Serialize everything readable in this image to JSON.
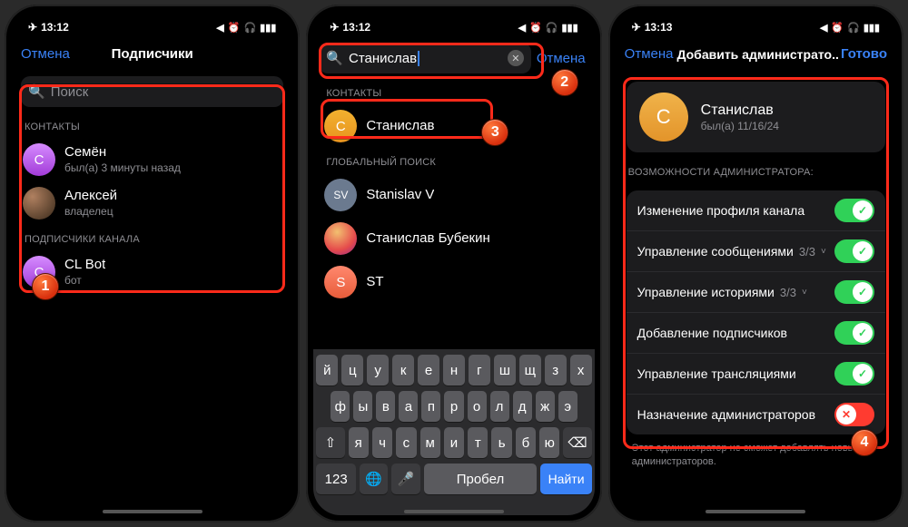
{
  "status": {
    "time1": "13:12",
    "time2": "13:12",
    "time3": "13:13"
  },
  "p1": {
    "cancel": "Отмена",
    "title": "Подписчики",
    "search_ph": "Поиск",
    "sec_contacts": "КОНТАКТЫ",
    "sec_subs": "ПОДПИСЧИКИ КАНАЛА",
    "c1": {
      "name": "Семён",
      "sub": "был(а) 3 минуты назад",
      "initial": "С"
    },
    "c2": {
      "name": "Алексей",
      "sub": "владелец"
    },
    "c3": {
      "name": "CL Bot",
      "sub": "бот",
      "initial": "C"
    }
  },
  "p2": {
    "cancel": "Отмена",
    "search_val": "Станислав",
    "sec_contacts": "КОНТАКТЫ",
    "sec_global": "ГЛОБАЛЬНЫЙ ПОИСК",
    "r1": {
      "name": "Станислав",
      "initial": "С"
    },
    "r2": {
      "name": "Stanislav V",
      "initial": "SV"
    },
    "r3": {
      "name": "Станислав Бубекин"
    },
    "r4": {
      "name": "ST",
      "initial": "S"
    },
    "kbd": {
      "r1": [
        "й",
        "ц",
        "у",
        "к",
        "е",
        "н",
        "г",
        "ш",
        "щ",
        "з",
        "х"
      ],
      "r2": [
        "ф",
        "ы",
        "в",
        "а",
        "п",
        "р",
        "о",
        "л",
        "д",
        "ж",
        "э"
      ],
      "r3": [
        "я",
        "ч",
        "с",
        "м",
        "и",
        "т",
        "ь",
        "б",
        "ю"
      ],
      "shift": "⇧",
      "bksp": "⌫",
      "num": "123",
      "globe": "🌐",
      "mic": "🎤",
      "space": "Пробел",
      "find": "Найти"
    }
  },
  "p3": {
    "cancel": "Отмена",
    "title": "Добавить администрато...",
    "done": "Готово",
    "profile": {
      "name": "Станислав",
      "sub": "был(а) 11/16/24",
      "initial": "С"
    },
    "sec": "ВОЗМОЖНОСТИ АДМИНИСТРАТОРА:",
    "perms": [
      {
        "label": "Изменение профиля канала",
        "on": true
      },
      {
        "label": "Управление сообщениями",
        "count": "3/3",
        "chev": true,
        "on": true
      },
      {
        "label": "Управление историями",
        "count": "3/3",
        "chev": true,
        "on": true
      },
      {
        "label": "Добавление подписчиков",
        "on": true
      },
      {
        "label": "Управление трансляциями",
        "on": true
      },
      {
        "label": "Назначение администраторов",
        "on": false
      }
    ],
    "hint": "Этот администратор не сможет добавлять новых администраторов."
  }
}
